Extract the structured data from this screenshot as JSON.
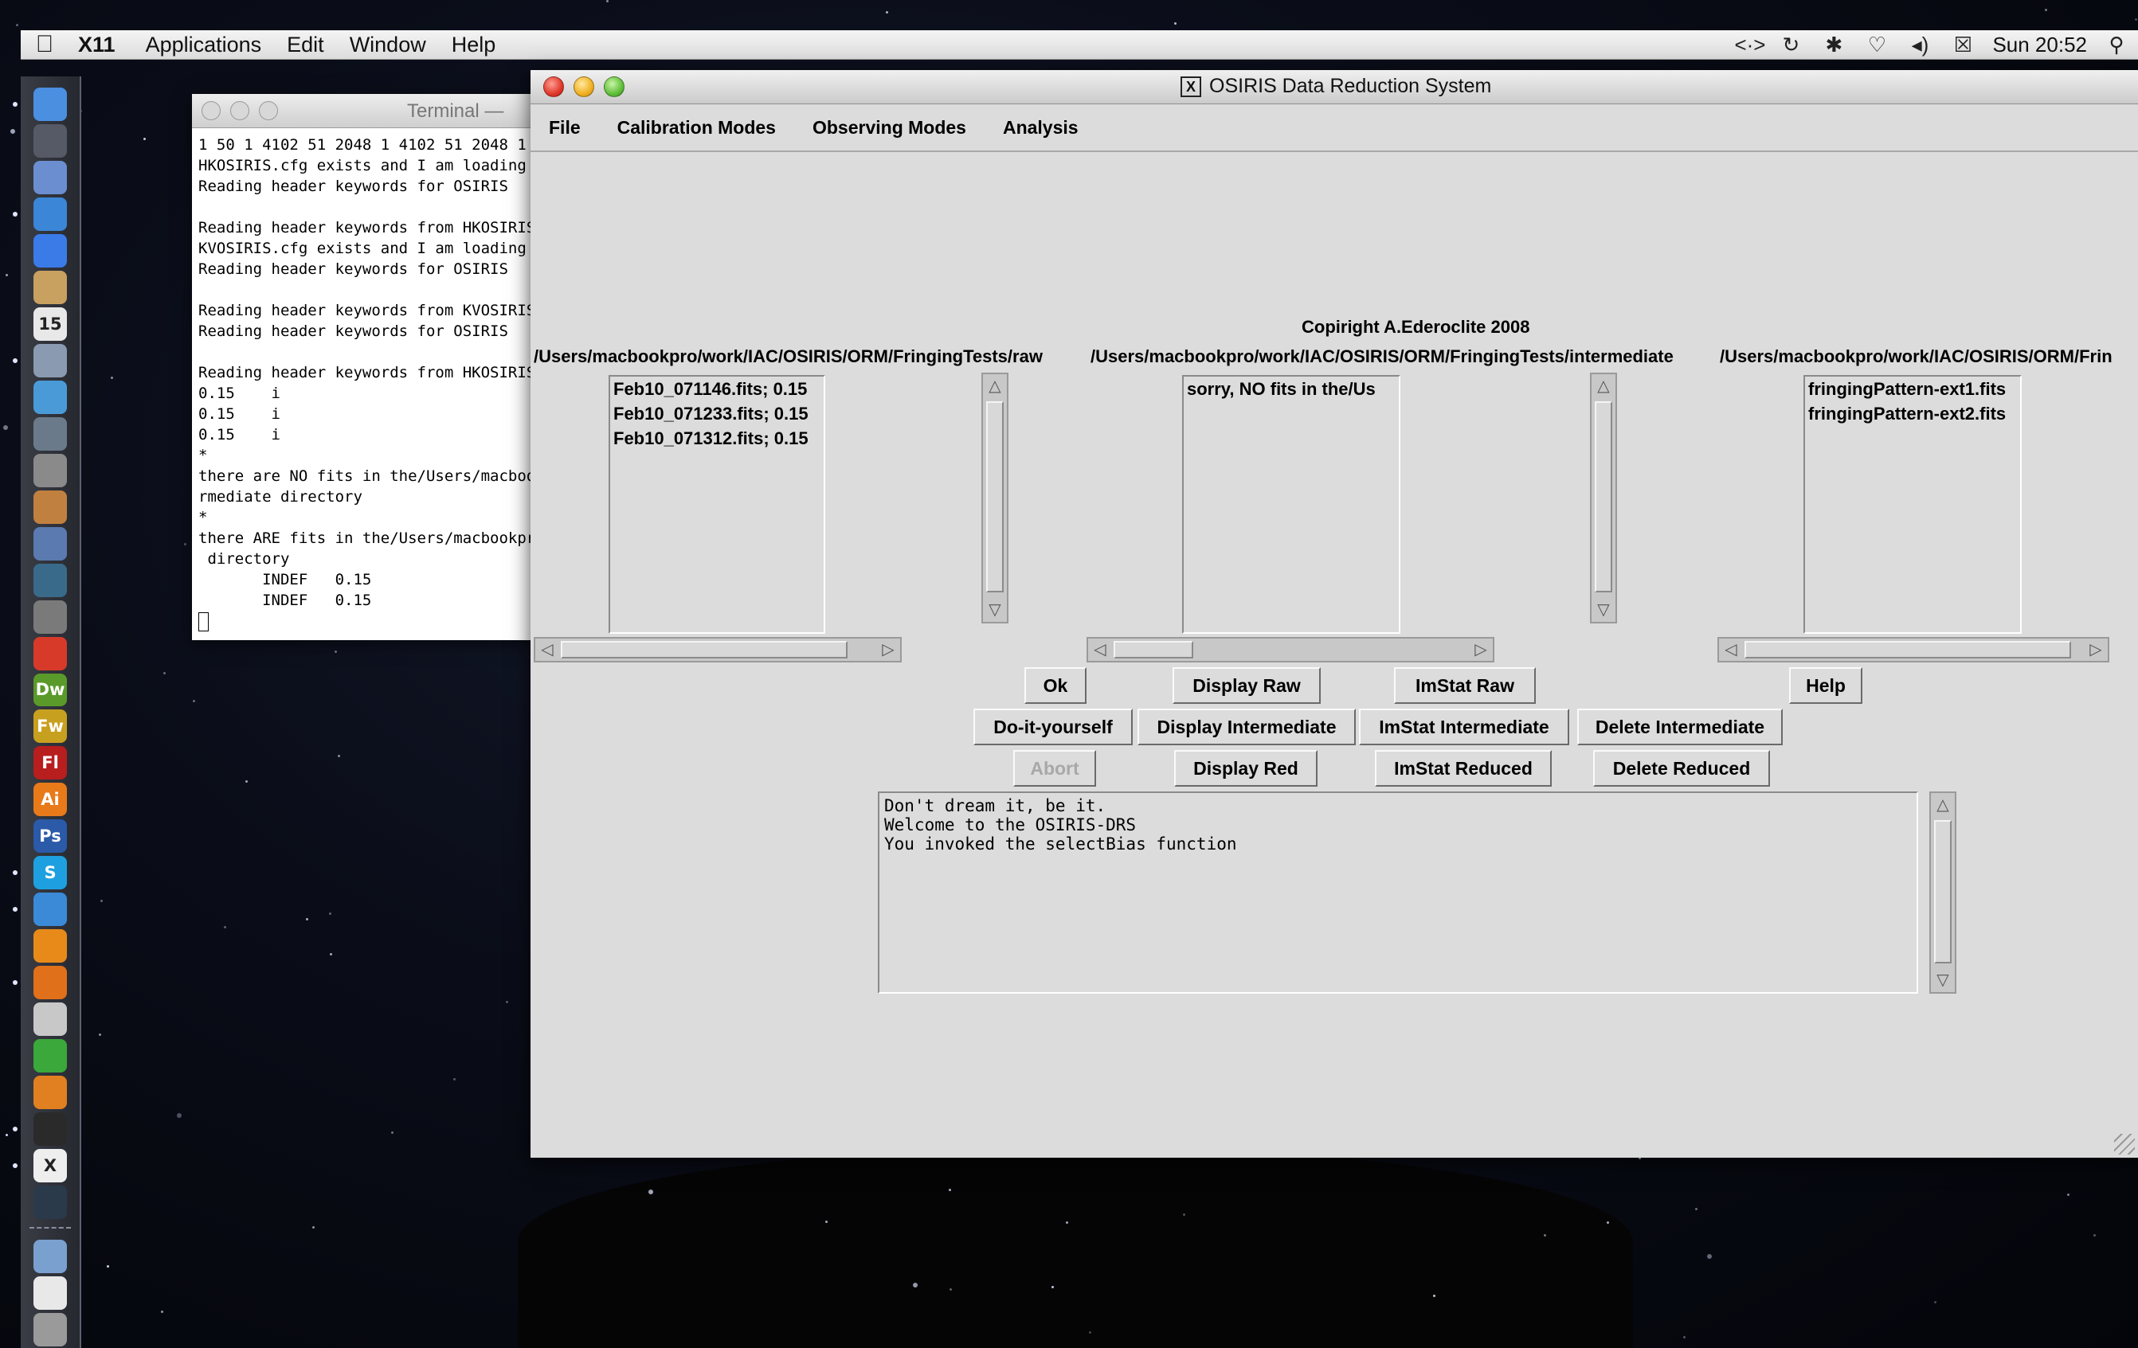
{
  "menubar": {
    "apple_icon": "apple-logo-icon",
    "app_name": "X11",
    "items": [
      "Applications",
      "Edit",
      "Window",
      "Help"
    ],
    "clock": "Sun 20:52",
    "status_icons": [
      "code-arrows-icon",
      "time-machine-icon",
      "bluetooth-icon",
      "wifi-icon",
      "volume-icon",
      "battery-icon",
      "spotlight-search-icon"
    ]
  },
  "dock": {
    "items": [
      {
        "name": "finder-icon",
        "label": "",
        "color": "#4a8fe0",
        "running": true
      },
      {
        "name": "dashboard-icon",
        "label": "",
        "color": "#555a66",
        "running": false
      },
      {
        "name": "mail-icon",
        "label": "",
        "color": "#6a8ed0",
        "running": false
      },
      {
        "name": "safari-icon",
        "label": "",
        "color": "#3b86d6",
        "running": true
      },
      {
        "name": "ichat-icon",
        "label": "",
        "color": "#3a7be8",
        "running": false
      },
      {
        "name": "address-book-icon",
        "label": "",
        "color": "#c8a060",
        "running": false
      },
      {
        "name": "ical-icon",
        "label": "15",
        "color": "#e8e8e8",
        "running": false
      },
      {
        "name": "preview-icon",
        "label": "",
        "color": "#8a9ab0",
        "running": true
      },
      {
        "name": "itunes-icon",
        "label": "",
        "color": "#4a9ad8",
        "running": false
      },
      {
        "name": "iphoto-icon",
        "label": "",
        "color": "#6a7a8a",
        "running": false
      },
      {
        "name": "imovie-icon",
        "label": "",
        "color": "#8a8a8a",
        "running": false
      },
      {
        "name": "garageband-icon",
        "label": "",
        "color": "#c08040",
        "running": false
      },
      {
        "name": "spaces-icon",
        "label": "",
        "color": "#5a7ab0",
        "running": false
      },
      {
        "name": "time-machine-icon",
        "label": "",
        "color": "#3a6a8a",
        "running": false
      },
      {
        "name": "system-preferences-icon",
        "label": "",
        "color": "#7a7a7a",
        "running": false
      },
      {
        "name": "acrobat-icon",
        "label": "",
        "color": "#d83a2a",
        "running": false
      },
      {
        "name": "dreamweaver-icon",
        "label": "Dw",
        "color": "#5a9a2a",
        "running": false
      },
      {
        "name": "fireworks-icon",
        "label": "Fw",
        "color": "#c8a020",
        "running": false
      },
      {
        "name": "flash-icon",
        "label": "Fl",
        "color": "#b81e1e",
        "running": false
      },
      {
        "name": "illustrator-icon",
        "label": "Ai",
        "color": "#e87a1a",
        "running": false
      },
      {
        "name": "photoshop-icon",
        "label": "Ps",
        "color": "#2a5aa8",
        "running": false
      },
      {
        "name": "skype-icon",
        "label": "S",
        "color": "#1ea0e0",
        "running": true
      },
      {
        "name": "messenger-icon",
        "label": "",
        "color": "#3a8ad8",
        "running": true
      },
      {
        "name": "vlc-icon",
        "label": "",
        "color": "#e88a1a",
        "running": false
      },
      {
        "name": "firefox-icon",
        "label": "",
        "color": "#e0701a",
        "running": true
      },
      {
        "name": "drive-icon",
        "label": "",
        "color": "#c8c8c8",
        "running": false
      },
      {
        "name": "network-icon",
        "label": "",
        "color": "#3aa83a",
        "running": false
      },
      {
        "name": "pages-icon",
        "label": "",
        "color": "#e08020",
        "running": false
      },
      {
        "name": "terminal-icon",
        "label": "",
        "color": "#2a2a2a",
        "running": true
      },
      {
        "name": "x11-icon",
        "label": "X",
        "color": "#eeeeee",
        "running": true
      },
      {
        "name": "activity-monitor-icon",
        "label": "",
        "color": "#2a3a4a",
        "running": false
      },
      {
        "name": "documents-folder-icon",
        "label": "",
        "color": "#7aa0d0",
        "running": false
      },
      {
        "name": "document-icon",
        "label": "",
        "color": "#e8e8e8",
        "running": false
      },
      {
        "name": "trash-icon",
        "label": "",
        "color": "#9a9a9a",
        "running": false
      }
    ]
  },
  "terminal": {
    "title": "Terminal — ",
    "lines": [
      "1 50 1 4102 51 2048 1 4102 51 2048 1",
      "HKOSIRIS.cfg exists and I am loading",
      "Reading header keywords for OSIRIS",
      "",
      "Reading header keywords from HKOSIRIS",
      "KVOSIRIS.cfg exists and I am loading",
      "Reading header keywords for OSIRIS",
      "",
      "Reading header keywords from KVOSIRIS",
      "Reading header keywords for OSIRIS",
      "",
      "Reading header keywords from HKOSIRIS",
      "0.15    i",
      "0.15    i",
      "0.15    i",
      "*",
      "there are NO fits in the/Users/macboo",
      "rmediate directory",
      "*",
      "there ARE fits in the/Users/macbookpr",
      " directory",
      "       INDEF   0.15",
      "       INDEF   0.15"
    ]
  },
  "osiris": {
    "title": "OSIRIS Data Reduction System",
    "menu": [
      "File",
      "Calibration Modes",
      "Observing Modes",
      "Analysis"
    ],
    "copyright": "Copiright A.Ederoclite 2008",
    "paths": {
      "raw": "/Users/macbookpro/work/IAC/OSIRIS/ORM/FringingTests/raw",
      "intermediate": "/Users/macbookpro/work/IAC/OSIRIS/ORM/FringingTests/intermediate",
      "reduced": "/Users/macbookpro/work/IAC/OSIRIS/ORM/Frin"
    },
    "lists": {
      "raw": [
        "Feb10_071146.fits; 0.15",
        "Feb10_071233.fits; 0.15",
        "Feb10_071312.fits; 0.15"
      ],
      "intermediate": [
        "sorry, NO fits in the/Us"
      ],
      "reduced": [
        "fringingPattern-ext1.fits",
        "fringingPattern-ext2.fits"
      ]
    },
    "buttons": {
      "ok": "Ok",
      "display_raw": "Display Raw",
      "imstat_raw": "ImStat Raw",
      "help": "Help",
      "do_it_yourself": "Do-it-yourself",
      "display_intermediate": "Display Intermediate",
      "imstat_intermediate": "ImStat Intermediate",
      "delete_intermediate": "Delete Intermediate",
      "abort": "Abort",
      "display_red": "Display Red",
      "imstat_reduced": "ImStat Reduced",
      "delete_reduced": "Delete Reduced"
    },
    "output_text": [
      "Don't dream it, be it.",
      "Welcome to the OSIRIS-DRS",
      "You invoked the selectBias function"
    ]
  }
}
